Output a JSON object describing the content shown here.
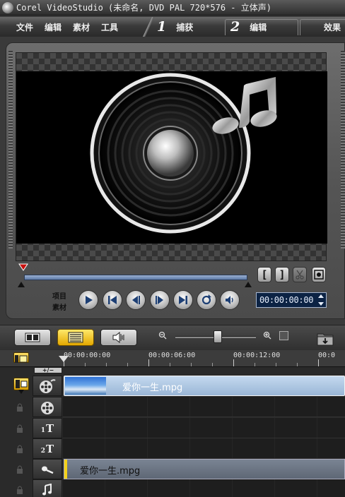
{
  "window": {
    "title": "Corel VideoStudio (未命名, DVD PAL 720*576 - 立体声)"
  },
  "menu": {
    "items": [
      {
        "label": "文件"
      },
      {
        "label": "编辑"
      },
      {
        "label": "素材"
      },
      {
        "label": "工具"
      }
    ]
  },
  "steps": [
    {
      "number": "1",
      "label": "捕获"
    },
    {
      "number": "2",
      "label": "编辑"
    },
    {
      "number": "",
      "label": "效果"
    }
  ],
  "preview": {
    "mode_project_label": "项目",
    "mode_clip_label": "素材",
    "mark_in_label": "[",
    "mark_out_label": "]",
    "timecode": "00:00:00:00",
    "scrub_position": 0
  },
  "view": {
    "active_view": "timeline",
    "zoom_level": 0.5
  },
  "timeline": {
    "ruler_ticks": [
      "00:00:00:00",
      "00:00:06:00",
      "00:00:12:00",
      "00:0"
    ],
    "add_remove_label": "+/−",
    "tracks": [
      {
        "type": "video",
        "clip_name": "爱你一生.mpg"
      },
      {
        "type": "overlay",
        "clip_name": ""
      },
      {
        "type": "title1",
        "label": "T",
        "index": "1"
      },
      {
        "type": "title2",
        "label": "T",
        "index": "2"
      },
      {
        "type": "voice",
        "clip_name": "爱你一生.mpg"
      },
      {
        "type": "music",
        "clip_name": ""
      }
    ]
  },
  "colors": {
    "accent_yellow": "#f0c21a",
    "timecode_bg": "#0c2344",
    "clip_blue": "#b2cbe6"
  }
}
